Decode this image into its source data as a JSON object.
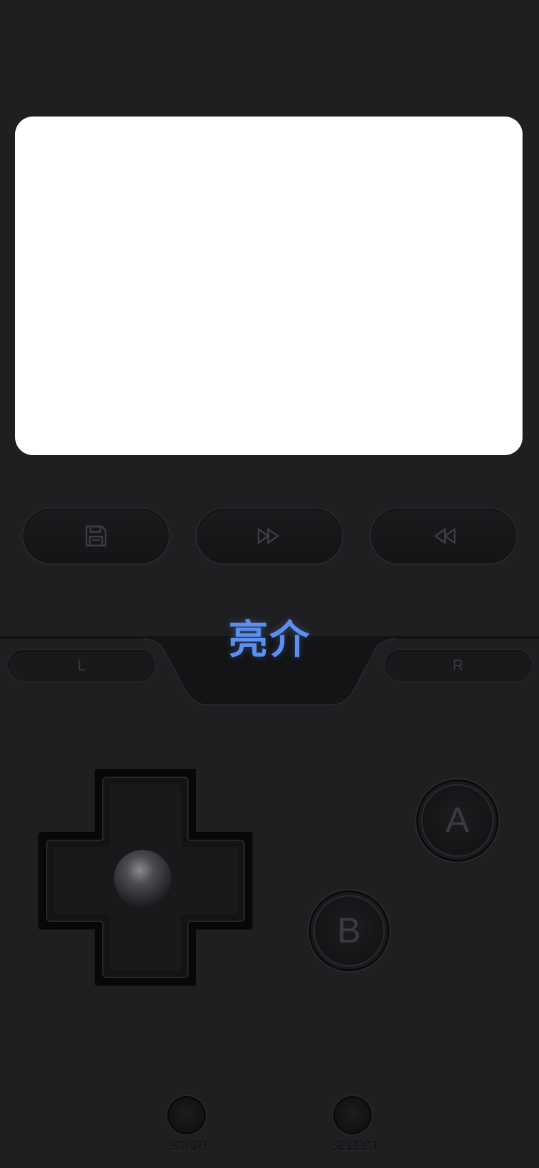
{
  "screen": {
    "background": "#ffffff"
  },
  "toolbar": {
    "save_icon": "floppy-disk-icon",
    "fast_forward_icon": "fast-forward-icon",
    "rewind_icon": "rewind-icon"
  },
  "shoulders": {
    "left_label": "L",
    "right_label": "R"
  },
  "brand": {
    "text": "亮介",
    "color": "#5b8ff0"
  },
  "dpad": {
    "icon": "dpad-icon"
  },
  "face_buttons": {
    "a_label": "A",
    "b_label": "B"
  },
  "system_buttons": {
    "start_label": "START",
    "select_label": "SELECT"
  },
  "colors": {
    "body": "#1f1f22",
    "accent": "#5b8ff0"
  }
}
